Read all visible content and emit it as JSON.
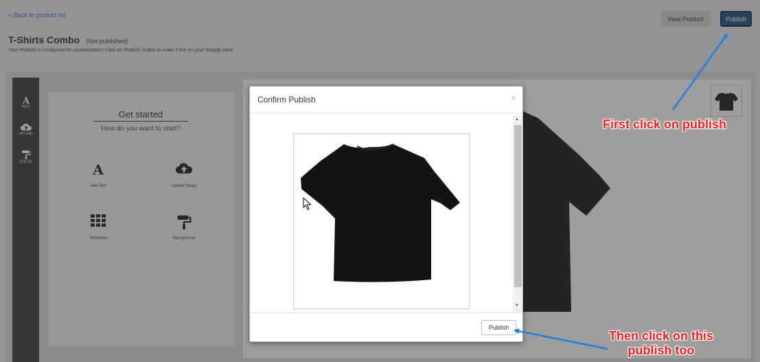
{
  "header": {
    "back_link": "< Back to product list",
    "title": "T-Shirts Combo",
    "status": "(Not published)",
    "subtitle": "Your Product is configured for customization! Click on 'Publish' button to make it live on your Shopify store.",
    "view_product": "View Product",
    "publish": "Publish"
  },
  "tools": [
    {
      "label": "TEXT",
      "icon": "text-icon"
    },
    {
      "label": "UPLOAD",
      "icon": "cloud-upload-icon"
    },
    {
      "label": "COLOR",
      "icon": "paint-roller-icon"
    }
  ],
  "panel": {
    "title": "Get started",
    "subtitle": "How do you want to start?",
    "options": [
      {
        "label": "Add Text",
        "icon": "text-icon"
      },
      {
        "label": "Upload Image",
        "icon": "cloud-upload-icon"
      },
      {
        "label": "Templates",
        "icon": "grid-icon"
      },
      {
        "label": "Background",
        "icon": "paint-roller-icon"
      }
    ]
  },
  "modal": {
    "title": "Confirm Publish",
    "close": "×",
    "publish": "Publish"
  },
  "annotations": {
    "first": "First click on publish",
    "second_line1": "Then click on this",
    "second_line2": "publish too"
  },
  "colors": {
    "accent": "#1f4a78",
    "annotation": "#ff1a1a",
    "arrow": "#1e7fe0",
    "rail": "#333333"
  }
}
